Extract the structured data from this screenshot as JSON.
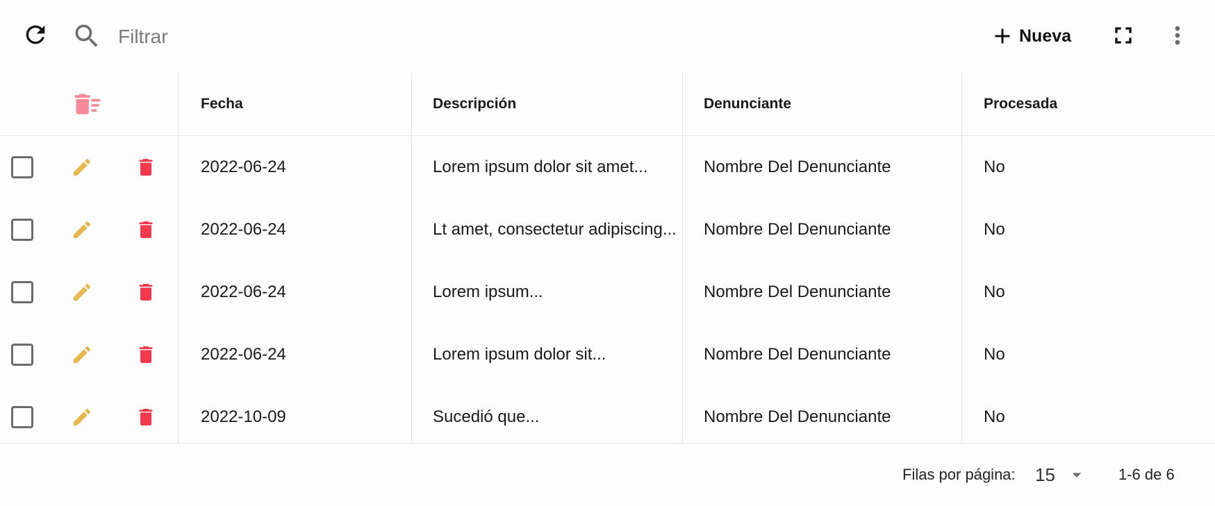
{
  "toolbar": {
    "refresh_icon": "refresh-icon",
    "search_icon": "search-icon",
    "filter_placeholder": "Filtrar",
    "new_label": "Nueva",
    "fullscreen_icon": "fullscreen-icon",
    "more_icon": "more-vert-icon"
  },
  "table": {
    "columns": [
      "Fecha",
      "Descripción",
      "Denunciante",
      "Procesada"
    ],
    "rows": [
      {
        "fecha": "2022-06-24",
        "descripcion": "Lorem ipsum dolor sit amet...",
        "denunciante": "Nombre Del Denunciante",
        "procesada": "No"
      },
      {
        "fecha": "2022-06-24",
        "descripcion": "Lt amet, consectetur adipiscing...",
        "denunciante": "Nombre Del Denunciante",
        "procesada": "No"
      },
      {
        "fecha": "2022-06-24",
        "descripcion": "Lorem ipsum...",
        "denunciante": "Nombre Del Denunciante",
        "procesada": "No"
      },
      {
        "fecha": "2022-06-24",
        "descripcion": "Lorem ipsum dolor sit...",
        "denunciante": "Nombre Del Denunciante",
        "procesada": "No"
      },
      {
        "fecha": "2022-10-09",
        "descripcion": "Sucedió que...",
        "denunciante": "Nombre Del Denunciante",
        "procesada": "No"
      }
    ]
  },
  "footer": {
    "rows_per_page_label": "Filas por página:",
    "rows_per_page_value": "15",
    "range_label": "1-6 de 6"
  },
  "colors": {
    "edit": "#e8b84f",
    "delete": "#f23a4c",
    "bulk_delete": "#f58a96",
    "divider": "#e2e2e2"
  }
}
